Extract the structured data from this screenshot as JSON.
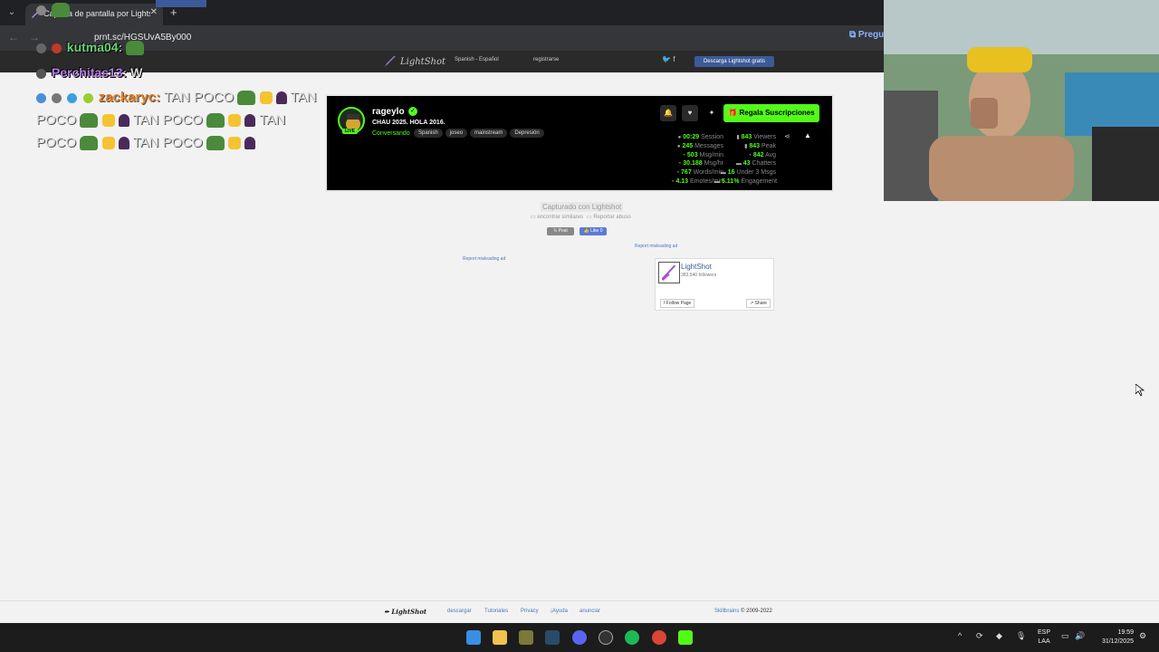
{
  "browser": {
    "tab_title": "Captura de pantalla por Lightshot",
    "url": "prnt.sc/HGSUvA5By000",
    "ask_label": "Pregu"
  },
  "lightshot_header": {
    "logo": "LightShot",
    "language": "Spanish - Español",
    "register": "registrarse",
    "download_button": "Descarga Lightshot gratis"
  },
  "chat": {
    "line1_user": "kutma04:",
    "line2_user": "Perchitas13:",
    "line2_msg": "W",
    "line3_user": "zackaryc:",
    "spam_word": "TAN POCO",
    "spam_word_split": "TAN",
    "spam_word_end": "POCO"
  },
  "stream_panel": {
    "streamer": "rageylo",
    "live_label": "LIVE",
    "title": "CHAU 2025. HOLA 2016.",
    "category": "Conversando",
    "tags": [
      "Spanish",
      "joseo",
      "mainstream",
      "Depresión"
    ],
    "sub_button": "Regala Suscripciones",
    "stats_left": [
      {
        "value": "00:29",
        "label": "Session"
      },
      {
        "value": "245",
        "label": "Messages"
      },
      {
        "value": "503",
        "label": "Msg/min"
      },
      {
        "value": "30.188",
        "label": "Msg/hr"
      },
      {
        "value": "767",
        "label": "Words/min"
      },
      {
        "value": "4.13",
        "label": "Emotes/min"
      }
    ],
    "stats_right": [
      {
        "value": "843",
        "label": "Viewers"
      },
      {
        "value": "843",
        "label": "Peak"
      },
      {
        "value": "842",
        "label": "Avg"
      },
      {
        "value": "43",
        "label": "Chatters"
      },
      {
        "value": "16",
        "label": "Under 3 Msgs"
      },
      {
        "value": "5.11%",
        "label": "Engagement"
      }
    ]
  },
  "page": {
    "captured_label": "Capturado con Lightshot",
    "similar_label": "encontrar similares",
    "report_label": "Reportar abuso",
    "post_label": "Post",
    "like_label": "Like 0",
    "ad_report_1": "Report misleading ad",
    "ad_report_2": "Report misleading ad"
  },
  "fb_box": {
    "name": "LightShot",
    "followers": "383,540 followers",
    "follow": "Follow Page",
    "share": "Share"
  },
  "footer": {
    "logo": "LightShot",
    "links": [
      "descargar",
      "Tutoriales",
      "Privacy",
      "¡Ayuda",
      "anunciar"
    ],
    "company": "Skillbrains",
    "copyright": "© 2009-2022"
  },
  "taskbar": {
    "lang_top": "ESP",
    "lang_bottom": "LAA",
    "time": "19:59",
    "date": "31/12/2025"
  }
}
